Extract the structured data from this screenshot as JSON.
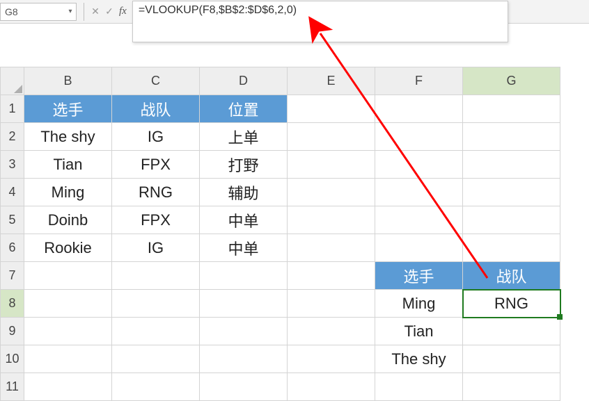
{
  "name_box": "G8",
  "formula": "=VLOOKUP(F8,$B$2:$D$6,2,0)",
  "columns": [
    "B",
    "C",
    "D",
    "E",
    "F",
    "G"
  ],
  "rows": [
    "1",
    "2",
    "3",
    "4",
    "5",
    "6",
    "7",
    "8",
    "9",
    "10",
    "11"
  ],
  "table1": {
    "header": {
      "B": "选手",
      "C": "战队",
      "D": "位置"
    },
    "rows": [
      {
        "B": "The shy",
        "C": "IG",
        "D": "上单"
      },
      {
        "B": "Tian",
        "C": "FPX",
        "D": "打野"
      },
      {
        "B": "Ming",
        "C": "RNG",
        "D": "辅助"
      },
      {
        "B": "Doinb",
        "C": "FPX",
        "D": "中单"
      },
      {
        "B": "Rookie",
        "C": "IG",
        "D": "中单"
      }
    ]
  },
  "table2": {
    "header": {
      "F": "选手",
      "G": "战队"
    },
    "rows": [
      {
        "F": "Ming",
        "G": "RNG"
      },
      {
        "F": "Tian",
        "G": ""
      },
      {
        "F": "The shy",
        "G": ""
      }
    ]
  },
  "active_cell": "G8",
  "icons": {
    "dropdown": "▾",
    "cancel": "✕",
    "enter": "✓"
  }
}
